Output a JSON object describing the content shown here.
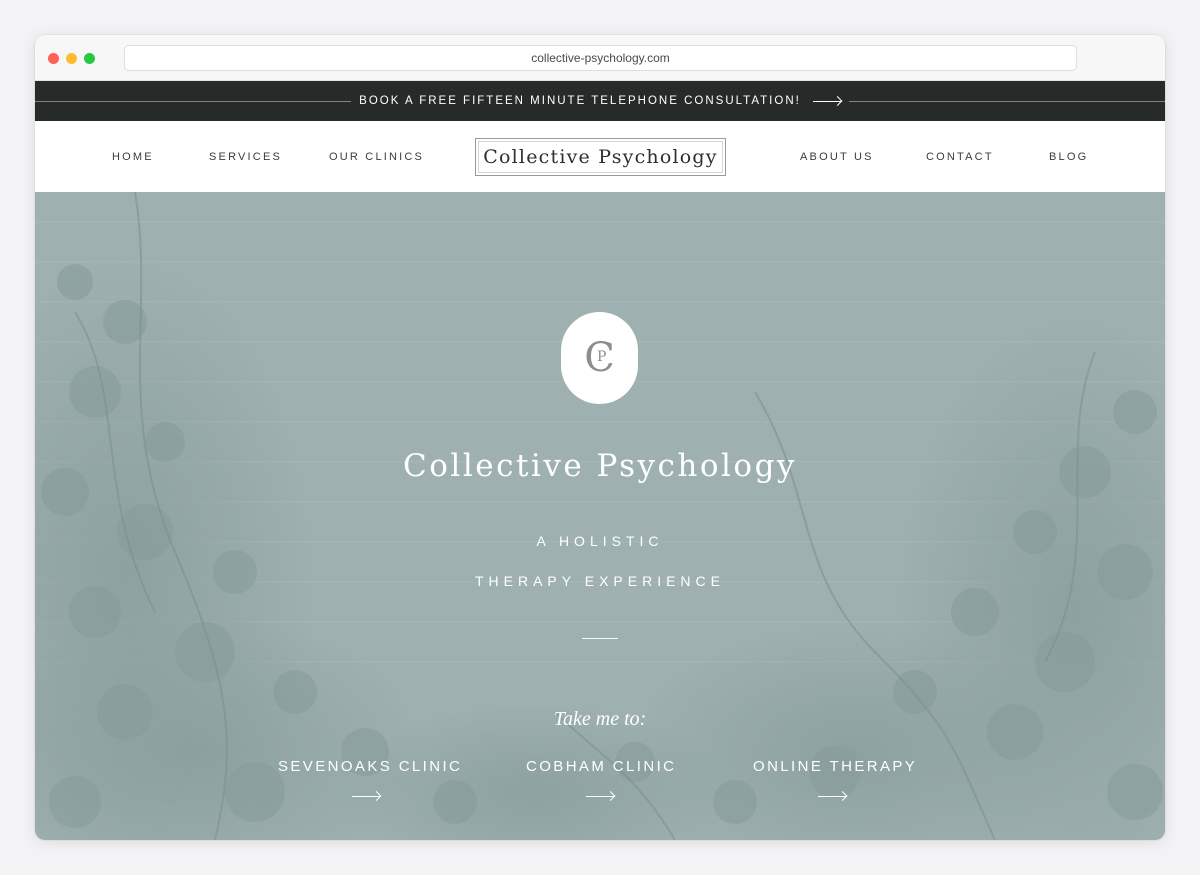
{
  "browser": {
    "url": "collective-psychology.com"
  },
  "announcement": {
    "text": "BOOK A FREE FIFTEEN MINUTE TELEPHONE CONSULTATION!",
    "icon": "arrow-right-icon"
  },
  "nav": {
    "left": [
      "HOME",
      "SERVICES",
      "OUR CLINICS"
    ],
    "logo": "Collective Psychology",
    "right": [
      "ABOUT US",
      "CONTACT",
      "BLOG"
    ]
  },
  "hero": {
    "monogram": {
      "c": "C",
      "p": "P"
    },
    "title": "Collective Psychology",
    "tagline_1": "A HOLISTIC",
    "tagline_2": "THERAPY EXPERIENCE",
    "take_me_to": "Take me to:",
    "clinics": [
      "SEVENOAKS CLINIC",
      "COBHAM CLINIC",
      "ONLINE THERAPY"
    ]
  },
  "colors": {
    "announcement_bg": "#262b29",
    "hero_bg": "#9eb0b0",
    "text_dark": "#3b3b3b",
    "text_light": "#ffffff"
  }
}
